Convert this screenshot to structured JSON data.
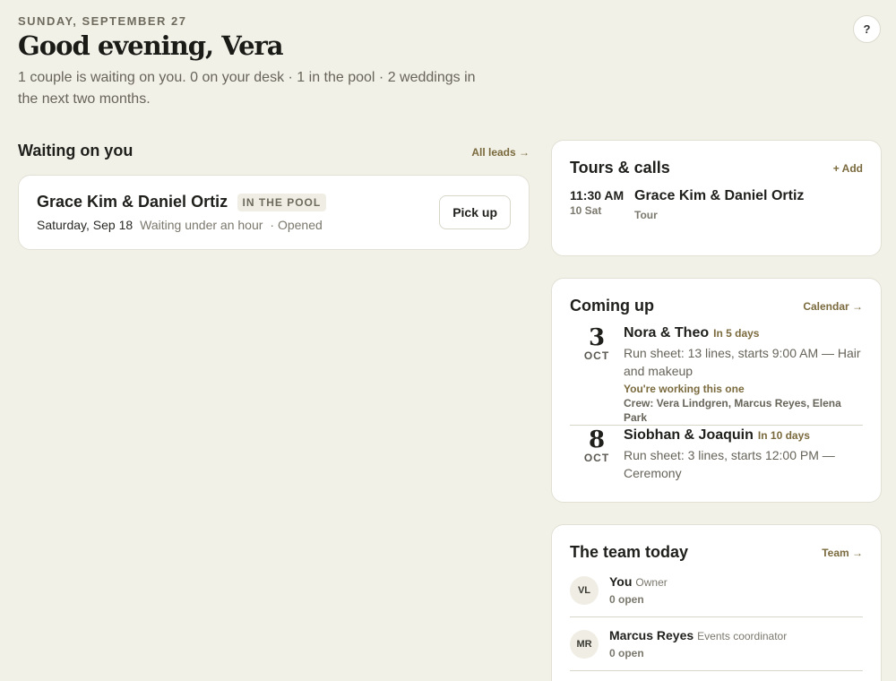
{
  "header": {
    "date": "SUNDAY, SEPTEMBER 27",
    "greeting": "Good evening, Vera",
    "summary": "1 couple is waiting on you. 0 on your desk · 1 in the pool · 2 weddings in the next two months.",
    "help_label": "?"
  },
  "waiting": {
    "title": "Waiting on you",
    "link": "All leads →",
    "lead": {
      "names": "Grace Kim & Daniel Ortiz",
      "badge": "IN THE POOL",
      "date": "Saturday, Sep 18",
      "waiting": "Waiting under an hour",
      "opened": "· Opened",
      "action": "Pick up"
    }
  },
  "tours": {
    "title": "Tours & calls",
    "link": "+ Add",
    "items": [
      {
        "time": "11:30 AM",
        "day": "10 Sat",
        "names": "Grace Kim & Daniel Ortiz",
        "type": "Tour"
      }
    ]
  },
  "coming": {
    "title": "Coming up",
    "link": "Calendar →",
    "events": [
      {
        "day": "3",
        "month": "OCT",
        "names": "Nora & Theo",
        "in": "In 5 days",
        "run": "Run sheet: 13 lines, starts 9:00 AM — Hair and makeup",
        "working": "You're working this one",
        "crew": "Crew: Vera Lindgren, Marcus Reyes, Elena Park"
      },
      {
        "day": "8",
        "month": "OCT",
        "names": "Siobhan & Joaquin",
        "in": "In 10 days",
        "run": "Run sheet: 3 lines, starts 12:00 PM — Ceremony"
      }
    ]
  },
  "team": {
    "title": "The team today",
    "link": "Team →",
    "members": [
      {
        "initials": "VL",
        "name": "You",
        "role": "Owner",
        "open": "0 open"
      },
      {
        "initials": "MR",
        "name": "Marcus Reyes",
        "role": "Events coordinator",
        "open": "0 open"
      }
    ]
  }
}
